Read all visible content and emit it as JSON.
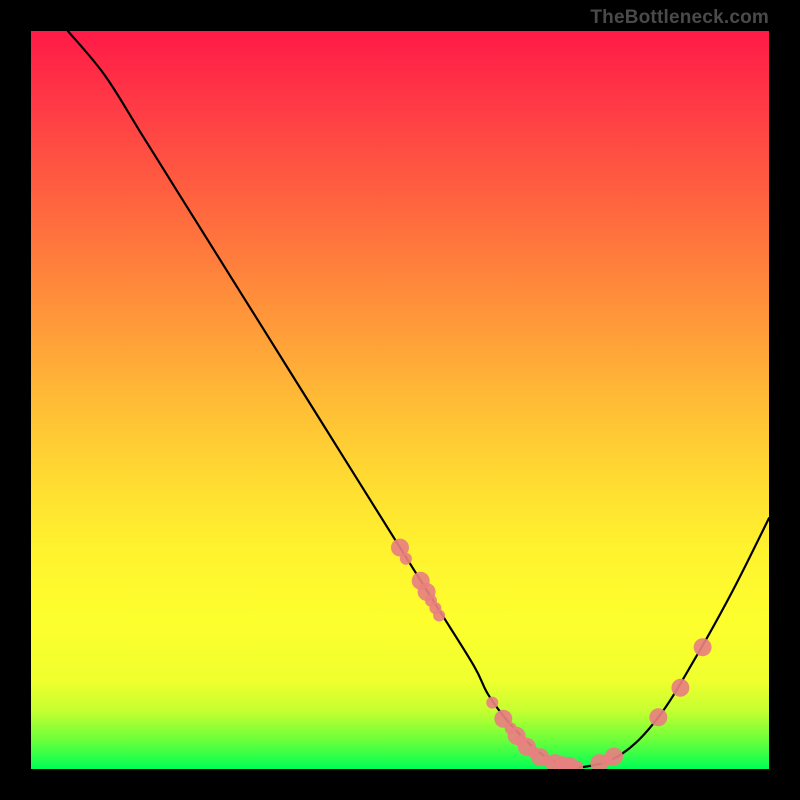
{
  "attribution": "TheBottleneck.com",
  "chart_data": {
    "type": "line",
    "title": "",
    "xlabel": "",
    "ylabel": "",
    "xlim": [
      0,
      100
    ],
    "ylim": [
      0,
      100
    ],
    "grid": false,
    "legend": false,
    "series": [
      {
        "name": "curve",
        "color": "#000000",
        "x": [
          5,
          10,
          15,
          20,
          25,
          30,
          35,
          40,
          45,
          50,
          55,
          60,
          62,
          65,
          68,
          70,
          72,
          75,
          80,
          85,
          90,
          95,
          100
        ],
        "y": [
          100,
          94,
          86,
          78,
          70,
          62,
          54,
          46,
          38,
          30,
          22,
          14,
          10,
          6,
          3,
          1.5,
          0.7,
          0.3,
          2,
          7,
          15,
          24,
          34
        ]
      }
    ],
    "scatter": {
      "name": "points",
      "color": "#e88080",
      "radius_major": 9,
      "radius_minor": 6,
      "points": [
        {
          "x": 50.0,
          "y": 30.0,
          "r": 9
        },
        {
          "x": 50.8,
          "y": 28.5,
          "r": 6
        },
        {
          "x": 52.8,
          "y": 25.5,
          "r": 9
        },
        {
          "x": 53.6,
          "y": 24.0,
          "r": 9
        },
        {
          "x": 54.2,
          "y": 22.8,
          "r": 6
        },
        {
          "x": 54.8,
          "y": 21.8,
          "r": 6
        },
        {
          "x": 55.3,
          "y": 20.8,
          "r": 6
        },
        {
          "x": 62.5,
          "y": 9.0,
          "r": 6
        },
        {
          "x": 64.0,
          "y": 6.8,
          "r": 9
        },
        {
          "x": 65.0,
          "y": 5.5,
          "r": 6
        },
        {
          "x": 65.8,
          "y": 4.5,
          "r": 9
        },
        {
          "x": 66.4,
          "y": 3.8,
          "r": 6
        },
        {
          "x": 67.2,
          "y": 3.0,
          "r": 9
        },
        {
          "x": 68.0,
          "y": 2.3,
          "r": 6
        },
        {
          "x": 69.0,
          "y": 1.6,
          "r": 9
        },
        {
          "x": 70.0,
          "y": 1.1,
          "r": 6
        },
        {
          "x": 71.0,
          "y": 0.8,
          "r": 9
        },
        {
          "x": 72.0,
          "y": 0.5,
          "r": 9
        },
        {
          "x": 73.0,
          "y": 0.4,
          "r": 9
        },
        {
          "x": 74.0,
          "y": 0.3,
          "r": 6
        },
        {
          "x": 77.0,
          "y": 0.8,
          "r": 9
        },
        {
          "x": 78.0,
          "y": 1.2,
          "r": 6
        },
        {
          "x": 79.0,
          "y": 1.7,
          "r": 9
        },
        {
          "x": 85.0,
          "y": 7.0,
          "r": 9
        },
        {
          "x": 88.0,
          "y": 11.0,
          "r": 9
        },
        {
          "x": 91.0,
          "y": 16.5,
          "r": 9
        }
      ]
    }
  }
}
